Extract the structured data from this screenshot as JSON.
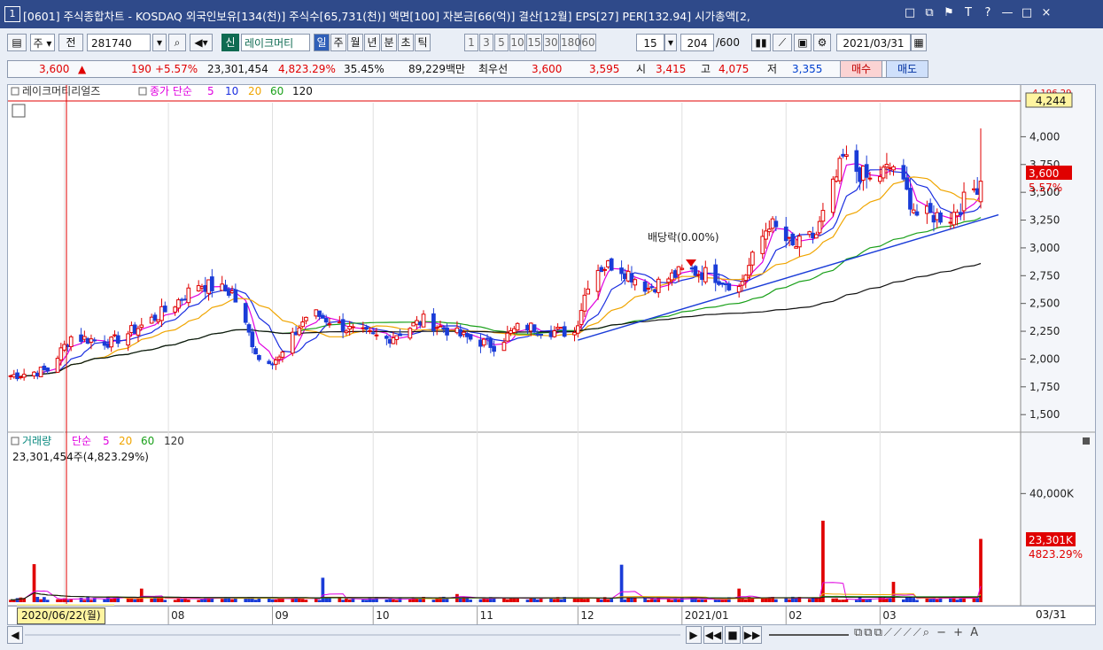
{
  "window": {
    "number": "1",
    "title": "[0601] 주식종합차트 - KOSDAQ 외국인보유[134(천)] 주식수[65,731(천)] 액면[100] 자본금[66(억)] 결산[12월] EPS[27] PER[132.94] 시가총액[2,",
    "buttons": [
      "□",
      "⧉",
      "⚑",
      "T",
      "?",
      "—",
      "□",
      "×"
    ]
  },
  "toolbar": {
    "stock_type": "주",
    "prev_label": "전",
    "code": "281740",
    "credit_label": "신",
    "stock_name": "레이크머티",
    "periods": [
      "일",
      "주",
      "월",
      "년",
      "분",
      "초",
      "틱"
    ],
    "active_period": "일",
    "intervals": [
      "1",
      "3",
      "5",
      "10",
      "15",
      "30",
      "180",
      "60"
    ],
    "interval_value": "15",
    "count": "204",
    "count_total": "/600",
    "date": "2021/03/31"
  },
  "quote": {
    "price": "3,600",
    "arrow": "▲",
    "change": "190",
    "change_pct": "+5.57%",
    "volume": "23,301,454",
    "volume_pct": "4,823.29%",
    "turnover": "35.45%",
    "amount": "89,229백만",
    "best_ask_label": "최우선",
    "ask": "3,600",
    "bid": "3,595",
    "open_label": "시",
    "open": "3,415",
    "high_label": "고",
    "high": "4,075",
    "low_label": "저",
    "low": "3,355",
    "buy_label": "매수",
    "sell_label": "매도"
  },
  "price_panel": {
    "name": "레이크머티리얼즈",
    "ma_label": "종가 단순",
    "ma_periods": [
      "5",
      "10",
      "20",
      "60",
      "120"
    ],
    "ma_colors": [
      "#e000e0",
      "#1a2ee0",
      "#f0a500",
      "#1aa01a",
      "#111111"
    ],
    "annotation": "배당락(0.00%)",
    "badge_top": "4,244",
    "badge_last": "3,600",
    "badge_last_pct": "5.57%",
    "cut_label": "4,196.29"
  },
  "volume_panel": {
    "title": "거래량",
    "ma_label": "단순",
    "ma_periods": [
      "5",
      "20",
      "60",
      "120"
    ],
    "summary": "23,301,454주(4,823.29%)",
    "badge": "23,301K",
    "badge_pct": "4823.29%"
  },
  "x_axis": {
    "cursor_date": "2020/06/22(월)",
    "right_label": "03/31"
  },
  "chart_data": {
    "type": "candlestick",
    "price_ylim": [
      1390,
      4290
    ],
    "price_ticks": [
      1500,
      1750,
      2000,
      2250,
      2500,
      2750,
      3000,
      3250,
      3500,
      3750,
      4000
    ],
    "price_tick_labels": [
      "1,500",
      "1,750",
      "2,000",
      "2,250",
      "2,500",
      "2,750",
      "3,000",
      "3,250",
      "3,500",
      "3,750",
      "4,000"
    ],
    "volume_ylim": [
      0,
      60000000
    ],
    "volume_ticks": [
      40000000
    ],
    "volume_tick_labels": [
      "40,000K"
    ],
    "months": [
      "2020/07",
      "2020/08",
      "2020/09",
      "2020/10",
      "2020/11",
      "2020/12",
      "2021/01",
      "2021/02",
      "2021/03"
    ],
    "month_labels": [
      "2020/07",
      "08",
      "09",
      "10",
      "11",
      "12",
      "2021/01",
      "02",
      "03"
    ],
    "close_anchors": [
      [
        "2020/06/15",
        1850
      ],
      [
        "2020/06/26",
        1900
      ],
      [
        "2020/07/03",
        2200
      ],
      [
        "2020/07/15",
        2150
      ],
      [
        "2020/07/24",
        2300
      ],
      [
        "2020/08/01",
        2450
      ],
      [
        "2020/08/10",
        2680
      ],
      [
        "2020/08/20",
        2600
      ],
      [
        "2020/08/28",
        2000
      ],
      [
        "2020/09/03",
        2000
      ],
      [
        "2020/09/12",
        2430
      ],
      [
        "2020/09/25",
        2250
      ],
      [
        "2020/10/05",
        2180
      ],
      [
        "2020/10/16",
        2350
      ],
      [
        "2020/10/28",
        2200
      ],
      [
        "2020/11/06",
        2120
      ],
      [
        "2020/11/14",
        2300
      ],
      [
        "2020/11/24",
        2250
      ],
      [
        "2020/11/30",
        2240
      ],
      [
        "2020/12/05",
        2800
      ],
      [
        "2020/12/12",
        2860
      ],
      [
        "2020/12/22",
        2640
      ],
      [
        "2021/01/02",
        2800
      ],
      [
        "2021/01/10",
        2760
      ],
      [
        "2021/01/18",
        2640
      ],
      [
        "2021/01/27",
        3230
      ],
      [
        "2021/02/03",
        3000
      ],
      [
        "2021/02/10",
        3120
      ],
      [
        "2021/02/18",
        3800
      ],
      [
        "2021/02/26",
        3600
      ],
      [
        "2021/03/05",
        3740
      ],
      [
        "2021/03/12",
        3300
      ],
      [
        "2021/03/22",
        3280
      ],
      [
        "2021/03/31",
        3600
      ]
    ],
    "last_candle": {
      "date": "2021/03/31",
      "open": 3415,
      "high": 4075,
      "low": 3355,
      "close": 3600
    },
    "trendlines": [
      {
        "start": [
          "2020/12/01",
          2170
        ],
        "end": [
          "2021/03/31",
          3250
        ]
      }
    ],
    "volume_spikes": [
      [
        "2020/06/22",
        14000000
      ],
      [
        "2020/07/24",
        5000000
      ],
      [
        "2020/09/16",
        9000000
      ],
      [
        "2020/10/26",
        3000000
      ],
      [
        "2020/12/14",
        13800000
      ],
      [
        "2021/01/18",
        5000000
      ],
      [
        "2021/02/12",
        30000000
      ],
      [
        "2021/03/05",
        7500000
      ],
      [
        "2021/03/31",
        23301454
      ]
    ]
  }
}
